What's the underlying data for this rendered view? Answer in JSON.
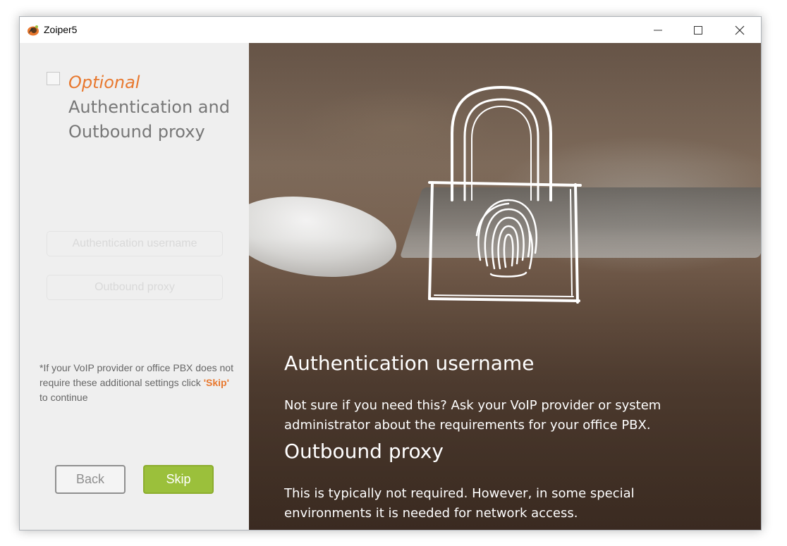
{
  "window": {
    "title": "Zoiper5",
    "controls": [
      "minimize-icon",
      "maximize-icon",
      "close-icon"
    ]
  },
  "left_panel": {
    "optional_label": "Optional",
    "heading_line1": "Authentication and",
    "heading_line2": "Outbound proxy",
    "auth_username_placeholder": "Authentication username",
    "outbound_proxy_placeholder": "Outbound proxy",
    "note_before": "*If your VoIP provider or office PBX does not require these additional settings click ",
    "note_skip": "'Skip'",
    "note_after": " to continue",
    "back_label": "Back",
    "skip_label": "Skip"
  },
  "right_panel": {
    "auth_title": "Authentication username",
    "auth_desc": "Not sure if you need this? Ask your VoIP provider or system administrator about the requirements for your office PBX.",
    "proxy_title": "Outbound proxy",
    "proxy_desc": "This is typically not required. However, in some special environments it is needed for network access.",
    "illustration_icon": "padlock-fingerprint-icon"
  },
  "colors": {
    "accent_orange": "#e8782e",
    "skip_green": "#9bc03b",
    "left_panel_bg": "#efefef",
    "heading_gray": "#777777"
  }
}
